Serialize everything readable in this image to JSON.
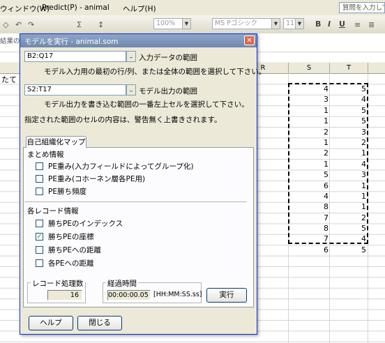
{
  "menu": {
    "items": [
      "ウィンドウ(W)",
      "Predict(P) - animal",
      "ヘルプ(H)"
    ],
    "question_box": "質問を入力して"
  },
  "toolbar": {
    "zoom": "100%",
    "font": "MS Pゴシック",
    "size": "11",
    "bold": "B",
    "italic": "I",
    "underline": "U"
  },
  "formula_bar": {
    "name_box": "結果の"
  },
  "sheet": {
    "columns": [
      "R",
      "S",
      "T"
    ],
    "a_cell": "たて",
    "rows": [
      {
        "s": "4",
        "t": "5"
      },
      {
        "s": "3",
        "t": "4"
      },
      {
        "s": "1",
        "t": "5"
      },
      {
        "s": "1",
        "t": "5"
      },
      {
        "s": "2",
        "t": "3"
      },
      {
        "s": "1",
        "t": "2"
      },
      {
        "s": "2",
        "t": "1"
      },
      {
        "s": "1",
        "t": "4"
      },
      {
        "s": "5",
        "t": "3"
      },
      {
        "s": "6",
        "t": "1"
      },
      {
        "s": "4",
        "t": "1"
      },
      {
        "s": "8",
        "t": "1"
      },
      {
        "s": "7",
        "t": "2"
      },
      {
        "s": "8",
        "t": "5"
      },
      {
        "s": "7",
        "t": "4"
      },
      {
        "s": "6",
        "t": "5"
      }
    ]
  },
  "dialog": {
    "title": "モデルを実行 - animal.som",
    "close": "✕",
    "input_range": {
      "value": "B2:Q17",
      "label": "入力データの範囲",
      "hint": "モデル入力用の最初の行/列、または全体の範囲を選択して下さい。"
    },
    "output_range": {
      "value": "S2:T17",
      "label": "モデル出力の範囲",
      "hint": "モデル出力を書き込む範囲の一番左上セルを選択して下さい。"
    },
    "warning": "指定された範囲のセルの内容は、警告無く上書きされます。",
    "tab": "自己組織化マップ",
    "summary": {
      "header": "まとめ情報",
      "items": [
        {
          "label": "PE重み(入力フィールドによってグループ化)",
          "checked": false
        },
        {
          "label": "PE重み(コホーネン層各PE用)",
          "checked": false
        },
        {
          "label": "PE勝ち頻度",
          "checked": false
        }
      ]
    },
    "records": {
      "header": "各レコード情報",
      "items": [
        {
          "label": "勝ちPEのインデックス",
          "checked": false
        },
        {
          "label": "勝ちPEの座標",
          "checked": true,
          "mark": "✓"
        },
        {
          "label": "勝ちPEへの距離",
          "checked": false
        },
        {
          "label": "各PEへの距離",
          "checked": false
        }
      ]
    },
    "records_processed": {
      "label": "レコード処理数",
      "value": "16"
    },
    "elapsed": {
      "label": "経過時間",
      "value": "00:00:00.05",
      "format": "[HH:MM:SS.ss]"
    },
    "run_button": "実行",
    "help_button": "ヘルプ",
    "close_button": "閉じる"
  }
}
